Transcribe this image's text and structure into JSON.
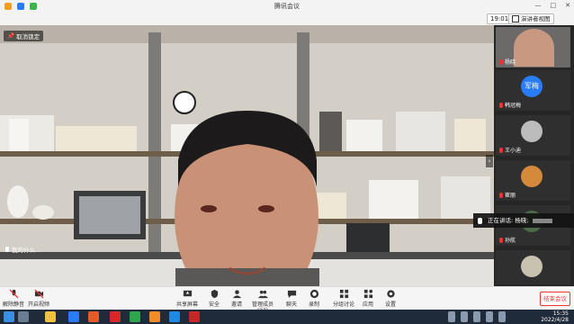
{
  "window": {
    "title": "腾讯会议"
  },
  "toolbar": {
    "time": "19:01",
    "speaker_view_label": "演讲者视图"
  },
  "stage": {
    "unlock_label": "取消锁定",
    "speaking_label": "我的什么..."
  },
  "sidebar": {
    "tiles": [
      {
        "name": "杨晓"
      },
      {
        "name": "韩冠梅",
        "avatar_text": "军梅",
        "avatar_color": "#2a7cf6"
      },
      {
        "name": "王小迪"
      },
      {
        "name": "崔丽"
      },
      {
        "name": "孙航"
      }
    ],
    "ticker_label": "正在讲话: 杨晓;"
  },
  "bottombar": {
    "buttons": [
      {
        "label": "解除静音",
        "icon": "mic-muted-icon"
      },
      {
        "label": "开启视频",
        "icon": "camera-off-icon"
      },
      {
        "label": "共享屏幕",
        "icon": "screen-share-icon"
      },
      {
        "label": "安全",
        "icon": "shield-icon"
      },
      {
        "label": "邀请",
        "icon": "invite-icon"
      },
      {
        "label": "管理成员(37)",
        "icon": "members-icon"
      },
      {
        "label": "聊天",
        "icon": "chat-icon"
      },
      {
        "label": "录制",
        "icon": "record-icon"
      },
      {
        "label": "分组讨论",
        "icon": "breakout-icon"
      },
      {
        "label": "应用",
        "icon": "apps-icon"
      },
      {
        "label": "设置",
        "icon": "gear-icon"
      }
    ],
    "end_label": "结束会议"
  },
  "taskbar": {
    "time": "15:35",
    "date": "2022/4/28"
  }
}
